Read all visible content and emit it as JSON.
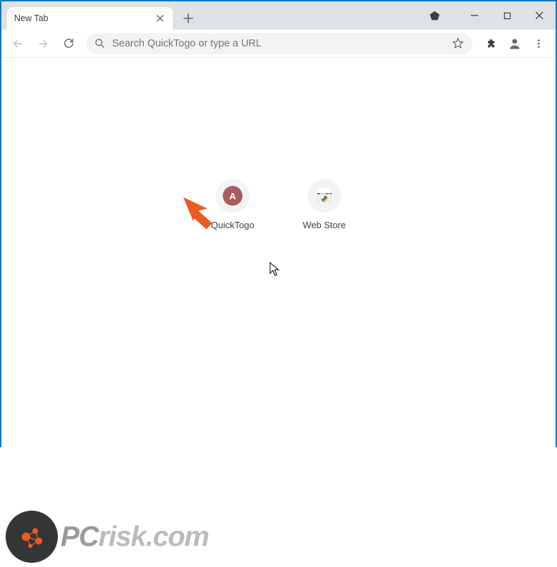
{
  "window": {
    "tab_title": "New Tab"
  },
  "omnibox": {
    "placeholder": "Search QuickTogo or type a URL"
  },
  "shortcuts": [
    {
      "label": "QuickTogo",
      "letter": "A"
    },
    {
      "label": "Web Store"
    }
  ],
  "watermark": {
    "pc": "PC",
    "risk": "risk",
    "com": ".com"
  },
  "colors": {
    "border": "#0879c4",
    "annotation": "#ec5a24",
    "quicktogo_avatar": "#a75d5d"
  }
}
